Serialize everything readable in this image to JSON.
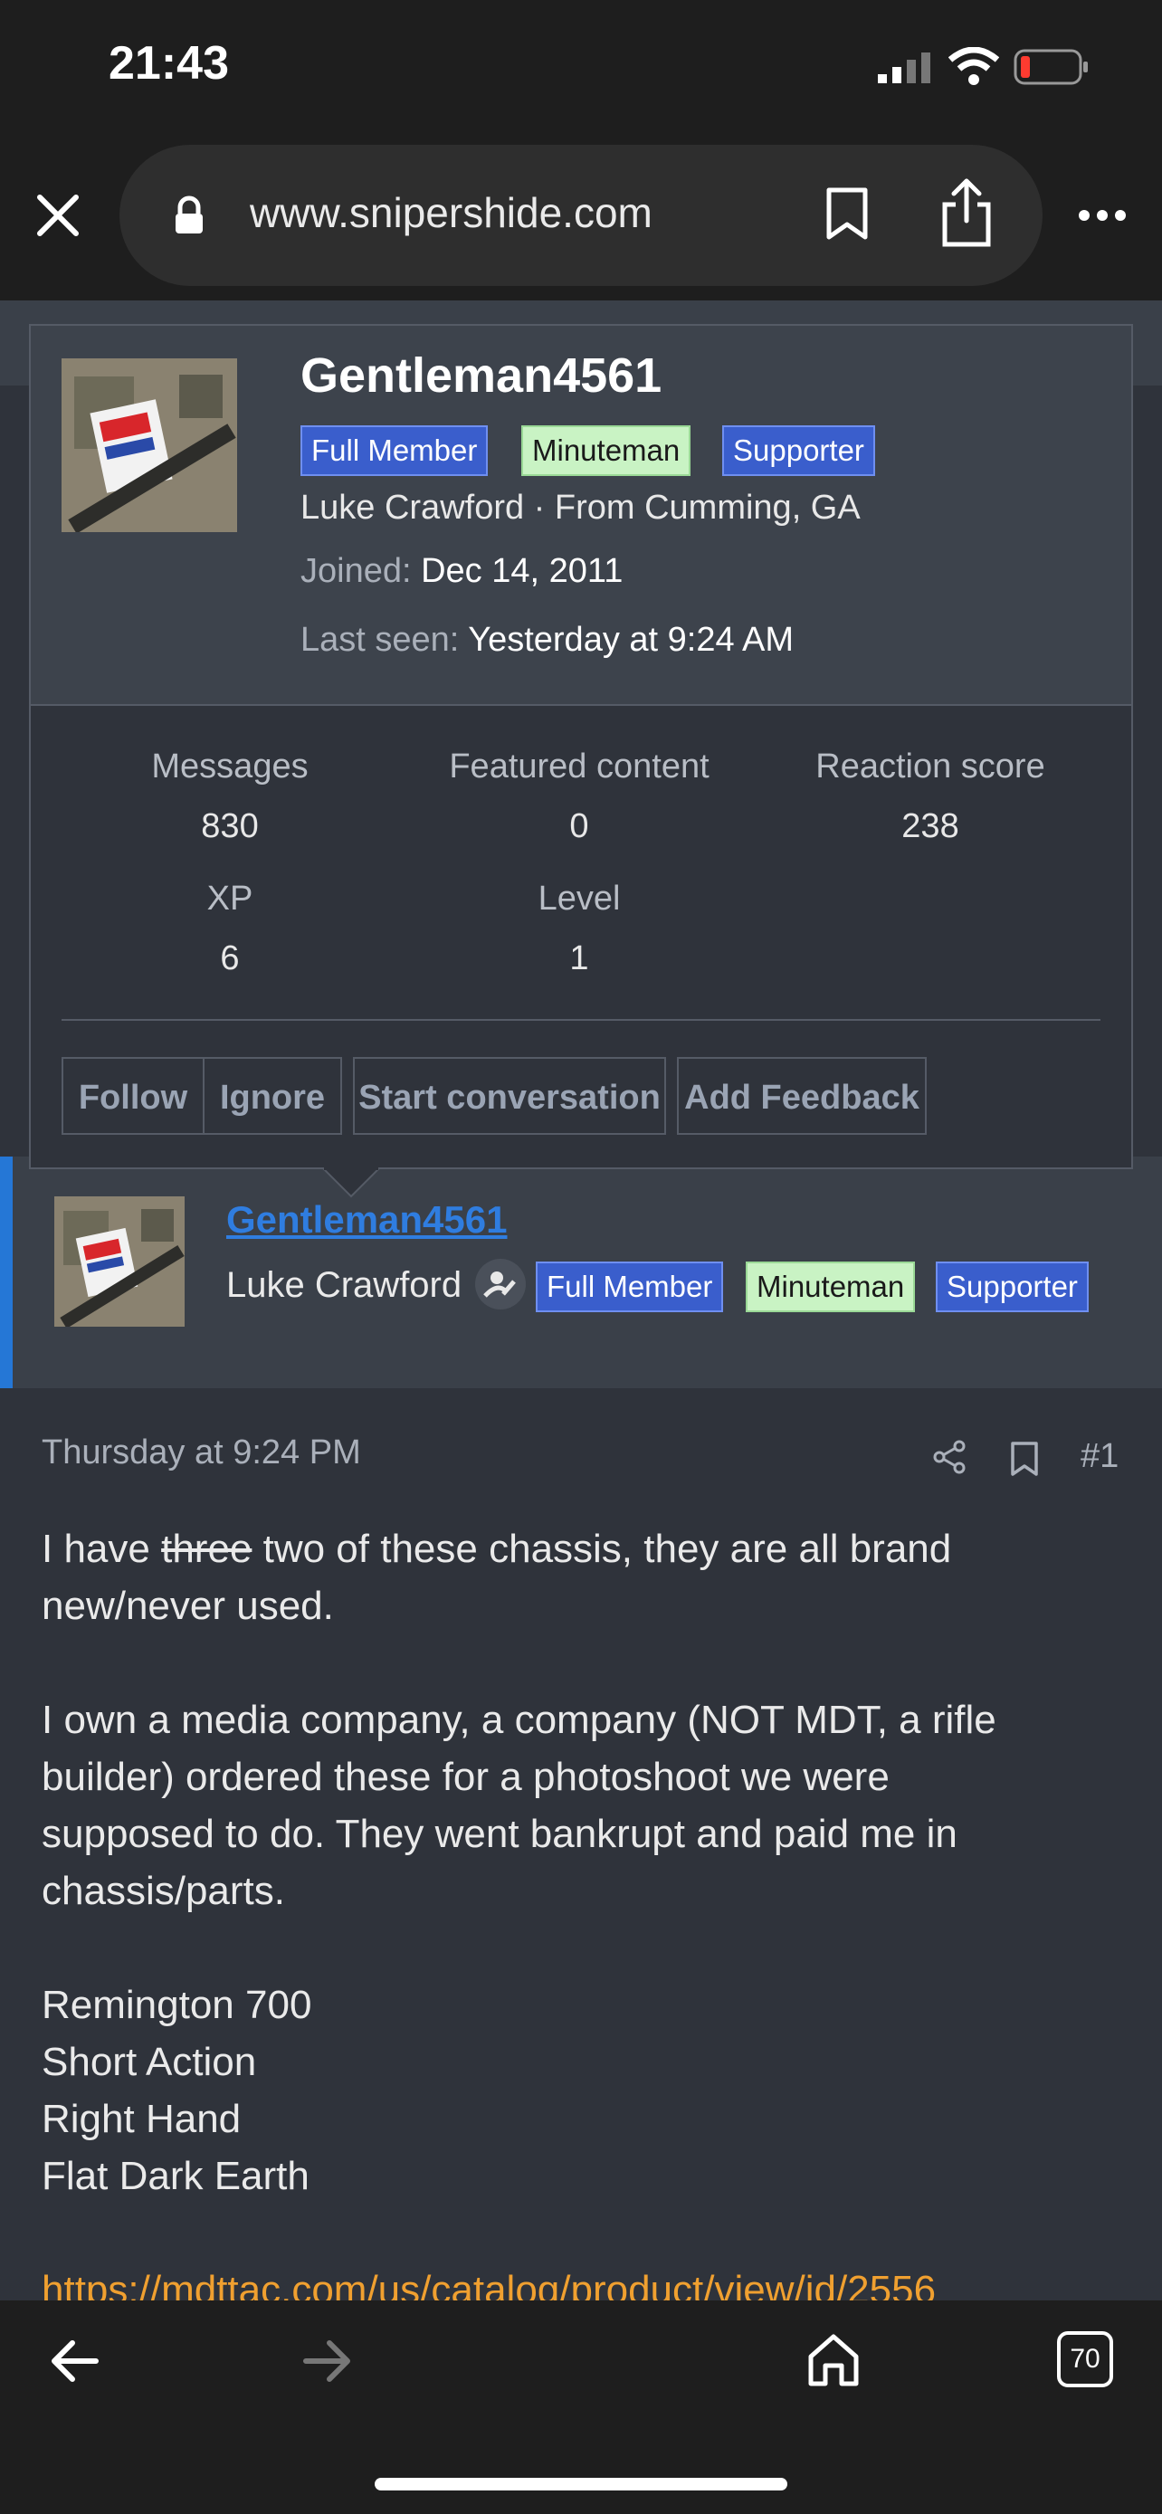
{
  "status_bar": {
    "time": "21:43"
  },
  "browser": {
    "url": "www.snipershide.com",
    "tab_count": "70"
  },
  "popup": {
    "username": "Gentleman4561",
    "badges": [
      "Full Member",
      "Minuteman",
      "Supporter"
    ],
    "blurb": "Luke Crawford · From Cumming, GA",
    "joined_label": "Joined:",
    "joined_value": "Dec 14, 2011",
    "last_seen_label": "Last seen:",
    "last_seen_value": "Yesterday at 9:24 AM",
    "stats": [
      {
        "label": "Messages",
        "value": "830"
      },
      {
        "label": "Featured content",
        "value": "0"
      },
      {
        "label": "Reaction score",
        "value": "238"
      },
      {
        "label": "XP",
        "value": "6"
      },
      {
        "label": "Level",
        "value": "1"
      }
    ],
    "actions": [
      "Follow",
      "Ignore",
      "Start conversation",
      "Add Feedback"
    ]
  },
  "post": {
    "username": "Gentleman4561",
    "real_name": "Luke Crawford",
    "badges": [
      "Full Member",
      "Minuteman",
      "Supporter"
    ],
    "date": "Thursday at 9:24 PM",
    "post_number": "#1",
    "body": {
      "p1_start": "I have ",
      "p1_strike": "three",
      "p1_line1_end": " two of these chassis, they are all brand",
      "p1_line2": "new/never used.",
      "p2_lines": [
        "I own a media company, a company (NOT MDT, a rifle",
        "builder) ordered these for a photoshoot we were",
        "supposed to do. They went bankrupt and paid me in",
        "chassis/parts."
      ],
      "spec_lines": [
        "Remington 700",
        "Short Action",
        "Right Hand",
        "Flat Dark Earth"
      ],
      "link": "https://mdttac.com/us/catalog/product/view/id/2556"
    }
  },
  "colors": {
    "accent": "#2577d6",
    "link": "#f0a030",
    "badge_blue": "#3a5ecc",
    "badge_green": "#c9f3c4"
  }
}
